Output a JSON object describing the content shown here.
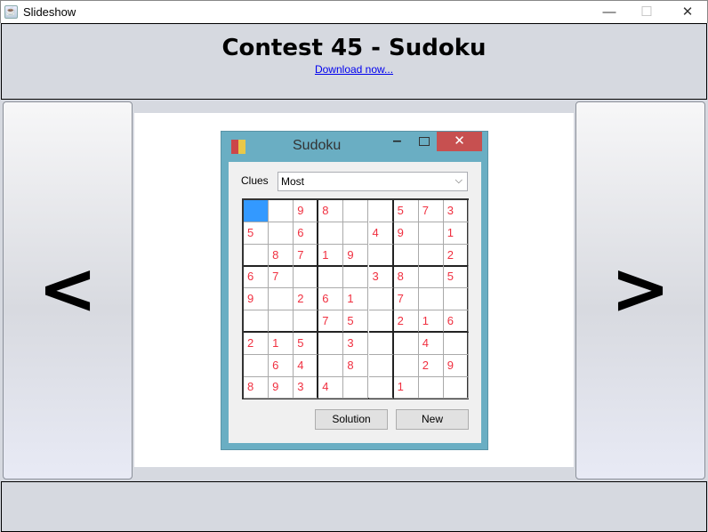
{
  "window": {
    "title": "Slideshow",
    "minimize": "—",
    "maximize": "☐",
    "close": "✕"
  },
  "header": {
    "title": "Contest 45 - Sudoku",
    "link": "Download now..."
  },
  "nav": {
    "prev": "<",
    "next": ">"
  },
  "sudoku": {
    "title": "Sudoku",
    "min": "‒",
    "close": "✕",
    "clues_label": "Clues",
    "clues_value": "Most",
    "selected_cell": [
      0,
      0
    ],
    "selected_color": "#3399ff",
    "digit_color": "#f03040",
    "grid": [
      [
        "",
        "",
        "9",
        "8",
        "",
        "",
        "5",
        "7",
        "3"
      ],
      [
        "5",
        "",
        "6",
        "",
        "",
        "4",
        "9",
        "",
        "1"
      ],
      [
        "",
        "8",
        "7",
        "1",
        "9",
        "",
        "",
        "",
        "2"
      ],
      [
        "6",
        "7",
        "",
        "",
        "",
        "3",
        "8",
        "",
        "5"
      ],
      [
        "9",
        "",
        "2",
        "6",
        "1",
        "",
        "7",
        "",
        ""
      ],
      [
        "",
        "",
        "",
        "7",
        "5",
        "",
        "2",
        "1",
        "6"
      ],
      [
        "2",
        "1",
        "5",
        "",
        "3",
        "",
        "",
        "4",
        ""
      ],
      [
        "",
        "6",
        "4",
        "",
        "8",
        "",
        "",
        "2",
        "9"
      ],
      [
        "8",
        "9",
        "3",
        "4",
        "",
        "",
        "1",
        "",
        ""
      ]
    ],
    "solution_label": "Solution",
    "new_label": "New"
  }
}
